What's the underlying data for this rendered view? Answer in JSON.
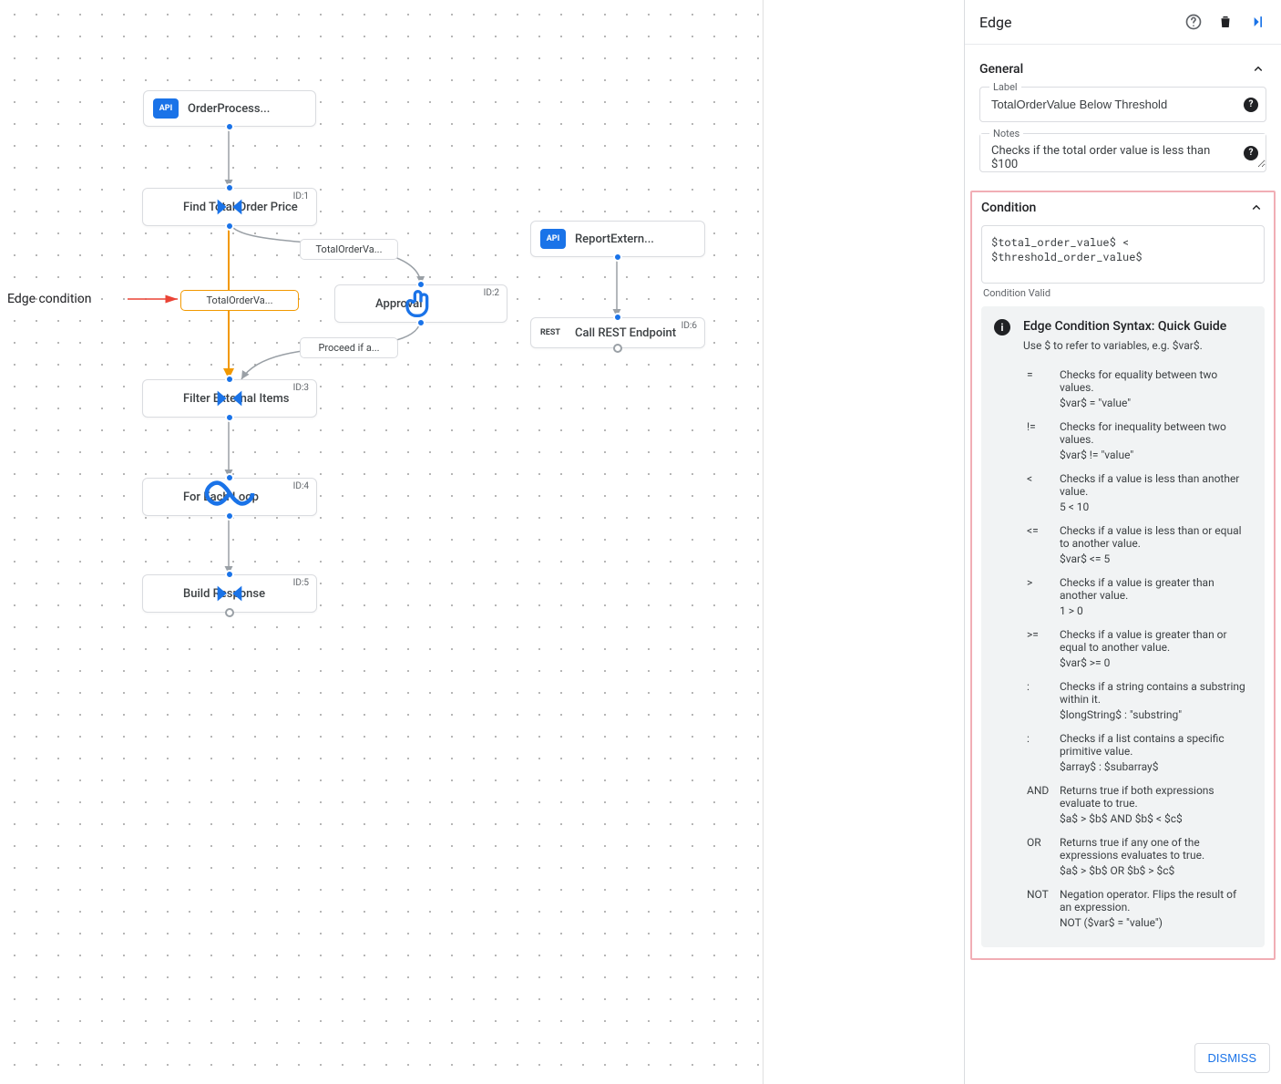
{
  "annotation": {
    "label": "Edge condition"
  },
  "nodes": {
    "start": {
      "title": "OrderProcess..."
    },
    "findTotal": {
      "title": "Find Total Order Price",
      "id": "ID:1"
    },
    "approval": {
      "title": "Approval",
      "id": "ID:2"
    },
    "filter": {
      "title": "Filter External Items",
      "id": "ID:3"
    },
    "loop": {
      "title": "For Each Loop",
      "id": "ID:4"
    },
    "build": {
      "title": "Build Response",
      "id": "ID:5"
    },
    "report": {
      "title": "ReportExtern..."
    },
    "rest": {
      "title": "Call REST Endpoint",
      "id": "ID:6"
    }
  },
  "edge_labels": {
    "below_threshold": "TotalOrderVa...",
    "at_or_above": "TotalOrderVa...",
    "proceed": "Proceed if a..."
  },
  "panel": {
    "title": "Edge",
    "general": {
      "heading": "General",
      "label_field": "Label",
      "label_value": "TotalOrderValue Below Threshold",
      "notes_field": "Notes",
      "notes_value": "Checks if the total order value is less than $100"
    },
    "condition": {
      "heading": "Condition",
      "expression": "$total_order_value$ < $threshold_order_value$",
      "valid_text": "Condition Valid",
      "guide_title": "Edge Condition Syntax: Quick Guide",
      "guide_sub": "Use $ to refer to variables, e.g. $var$.",
      "ops": [
        {
          "op": "=",
          "desc": "Checks for equality between two values.",
          "ex": "$var$ = \"value\""
        },
        {
          "op": "!=",
          "desc": "Checks for inequality between two values.",
          "ex": "$var$ != \"value\""
        },
        {
          "op": "<",
          "desc": "Checks if a value is less than another value.",
          "ex": "5 < 10"
        },
        {
          "op": "<=",
          "desc": "Checks if a value is less than or equal to another value.",
          "ex": "$var$ <= 5"
        },
        {
          "op": ">",
          "desc": "Checks if a value is greater than another value.",
          "ex": "1 > 0"
        },
        {
          "op": ">=",
          "desc": "Checks if a value is greater than or equal to another value.",
          "ex": "$var$ >= 0"
        },
        {
          "op": ":",
          "desc": "Checks if a string contains a substring within it.",
          "ex": "$longString$ : \"substring\""
        },
        {
          "op": ":",
          "desc": "Checks if a list contains a specific primitive value.",
          "ex": "$array$ : $subarray$"
        },
        {
          "op": "AND",
          "desc": "Returns true if both expressions evaluate to true.",
          "ex": "$a$ > $b$ AND $b$ < $c$"
        },
        {
          "op": "OR",
          "desc": "Returns true if any one of the expressions evaluates to true.",
          "ex": "$a$ > $b$ OR $b$ > $c$"
        },
        {
          "op": "NOT",
          "desc": "Negation operator. Flips the result of an expression.",
          "ex": "NOT ($var$ = \"value\")"
        }
      ],
      "dismiss": "DISMISS"
    }
  }
}
